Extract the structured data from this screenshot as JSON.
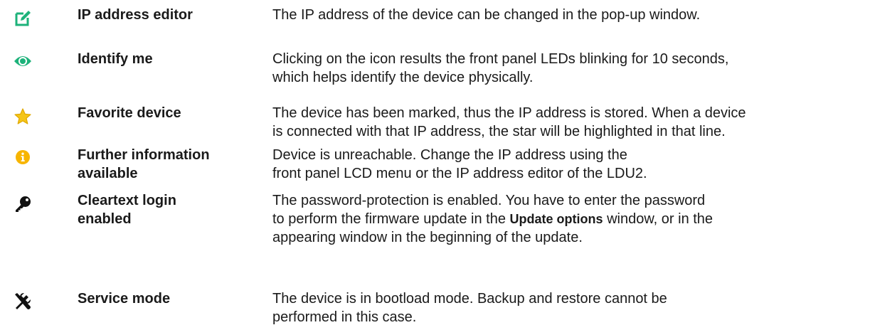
{
  "colors": {
    "accent_green": "#1db27a",
    "star_yellow": "#f5c518",
    "info_yellow": "#f7b500",
    "icon_black": "#111111"
  },
  "rows": [
    {
      "icon": "edit-icon",
      "name_lines": [
        "IP address editor"
      ],
      "desc_lines": [
        "The IP address of the device can be changed in the pop-up window."
      ]
    },
    {
      "icon": "eye-icon",
      "name_lines": [
        "Identify me"
      ],
      "desc_lines": [
        "Clicking on the icon results the front panel LEDs blinking for 10 seconds,",
        "which helps identify the device physically."
      ]
    },
    {
      "icon": "star-icon",
      "name_lines": [
        "Favorite device"
      ],
      "desc_lines": [
        "The device has been marked, thus the IP address is stored. When a device",
        "is connected with that IP address, the star will be highlighted in that line."
      ]
    },
    {
      "icon": "info-icon",
      "name_lines": [
        "Further information",
        "available"
      ],
      "desc_lines": [
        "Device is unreachable. Change the IP address using the",
        "front panel LCD menu or the IP address editor of the LDU2."
      ]
    },
    {
      "icon": "key-icon",
      "name_lines": [
        "Cleartext login",
        "enabled"
      ],
      "desc_lines": [
        "The password-protection is enabled. You have to enter the password",
        "to perform the firmware update in the",
        "window, or in the",
        "appearing window in the beginning of the update."
      ],
      "desc_bold": "Update options"
    },
    {
      "icon": "tools-icon",
      "name_lines": [
        "Service mode"
      ],
      "desc_lines": [
        "The device is in bootload mode. Backup and restore cannot be",
        "performed in this case."
      ]
    }
  ]
}
